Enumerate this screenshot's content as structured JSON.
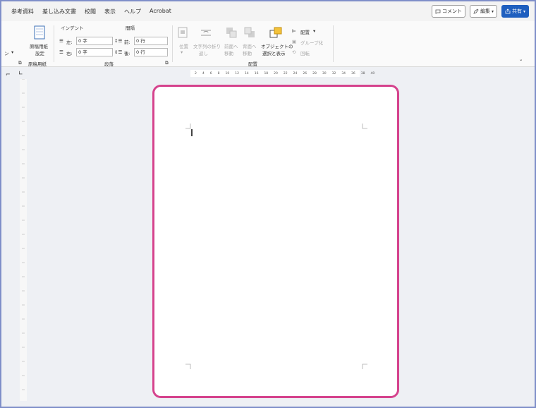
{
  "menu": {
    "items": [
      "参考資料",
      "差し込み文書",
      "校閲",
      "表示",
      "ヘルプ",
      "Acrobat"
    ]
  },
  "top_buttons": {
    "comment": "コメント",
    "edit": "編集",
    "share": "共有"
  },
  "ribbon": {
    "genko": {
      "label_line1": "原稿用紙",
      "label_line2": "設定",
      "group": "原稿用紙"
    },
    "indent": {
      "header": "インデント",
      "left_label": "左:",
      "left_value": "0 字",
      "right_label": "右:",
      "right_value": "0 字"
    },
    "spacing": {
      "header": "間隔",
      "before_label": "前:",
      "before_value": "0 行",
      "after_label": "後:",
      "after_value": "0 行"
    },
    "paragraph_group": "段落",
    "arrange": {
      "position": "位置",
      "wrap_line1": "文字列の折り",
      "wrap_line2": "返し",
      "forward_line1": "前面へ",
      "forward_line2": "移動",
      "backward_line1": "背面へ",
      "backward_line2": "移動",
      "select_line1": "オブジェクトの",
      "select_line2": "選択と表示",
      "align": "配置",
      "group_btn": "グループ化",
      "rotate": "回転",
      "group": "配置"
    },
    "left_cut": "ン"
  },
  "ruler": {
    "ticks": [
      "2",
      "4",
      "6",
      "8",
      "10",
      "12",
      "14",
      "16",
      "18",
      "20",
      "22",
      "24",
      "26",
      "28",
      "30",
      "32",
      "34",
      "36",
      "38",
      "40"
    ]
  },
  "colors": {
    "highlight": "#d5438d",
    "frame": "#7f8fc9",
    "share": "#1f5fbf"
  }
}
